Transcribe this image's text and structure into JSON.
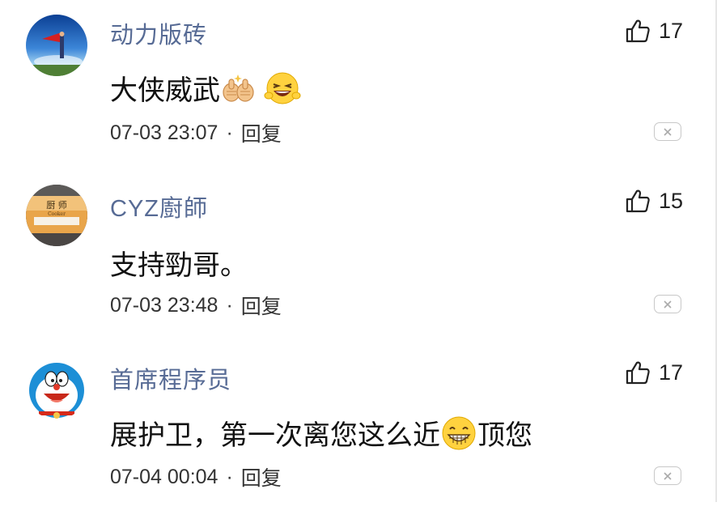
{
  "comments": [
    {
      "username": "动力版砖",
      "likes": "17",
      "content_text": "大侠威武",
      "content_emojis": [
        "thumbs-up-hands-emoji",
        "grinning-squint-emoji"
      ],
      "timestamp": "07-03 23:07",
      "separator": "·",
      "reply_label": "回复",
      "avatar": "superhero-avatar"
    },
    {
      "username": "CYZ廚師",
      "likes": "15",
      "content_text": "支持勁哥。",
      "timestamp": "07-03 23:48",
      "separator": "·",
      "reply_label": "回复",
      "avatar": "chef-sign-avatar",
      "avatar_text": "厨 师",
      "avatar_subtext": "Cooker"
    },
    {
      "username": "首席程序员",
      "likes": "17",
      "content_before": "展护卫，第一次离您这么近",
      "content_emoji": "grinning-teeth-emoji",
      "content_after": "顶您",
      "timestamp": "07-04 00:04",
      "separator": "·",
      "reply_label": "回复",
      "avatar": "doraemon-avatar"
    }
  ],
  "colors": {
    "username": "#576b95",
    "text": "#111111",
    "meta": "#333333",
    "border": "#c8c8c8"
  }
}
